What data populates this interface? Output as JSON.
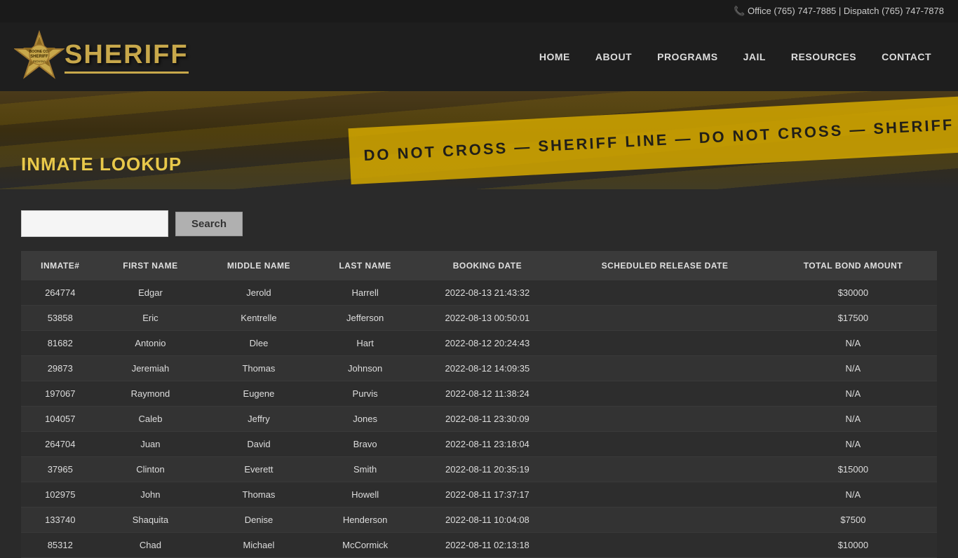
{
  "topbar": {
    "phone_icon": "📞",
    "office_label": "Office (765) 747-7885",
    "separator": "|",
    "dispatch_label": "Dispatch (765) 747-7878"
  },
  "nav": {
    "logo_text": "SHERIFF",
    "links": [
      {
        "label": "HOME",
        "id": "home"
      },
      {
        "label": "ABOUT",
        "id": "about"
      },
      {
        "label": "PROGRAMS",
        "id": "programs"
      },
      {
        "label": "JAIL",
        "id": "jail"
      },
      {
        "label": "RESOURCES",
        "id": "resources"
      },
      {
        "label": "CONTACT",
        "id": "contact"
      }
    ]
  },
  "hero": {
    "tape_text": "DO NOT CROSS — SHERIFF LINE — DO NOT CROSS — SHERIFF LINE — DO NOT CROSS",
    "page_title": "INMATE LOOKUP"
  },
  "search": {
    "input_value": "",
    "input_placeholder": "",
    "button_label": "Search"
  },
  "table": {
    "headers": [
      "INMATE#",
      "FIRST NAME",
      "MIDDLE NAME",
      "LAST NAME",
      "BOOKING DATE",
      "SCHEDULED RELEASE DATE",
      "TOTAL BOND AMOUNT"
    ],
    "rows": [
      {
        "id": "264774",
        "first": "Edgar",
        "middle": "Jerold",
        "last": "Harrell",
        "booking": "2022-08-13 21:43:32",
        "release": "",
        "bond": "$30000"
      },
      {
        "id": "53858",
        "first": "Eric",
        "middle": "Kentrelle",
        "last": "Jefferson",
        "booking": "2022-08-13 00:50:01",
        "release": "",
        "bond": "$17500"
      },
      {
        "id": "81682",
        "first": "Antonio",
        "middle": "Dlee",
        "last": "Hart",
        "booking": "2022-08-12 20:24:43",
        "release": "",
        "bond": "N/A"
      },
      {
        "id": "29873",
        "first": "Jeremiah",
        "middle": "Thomas",
        "last": "Johnson",
        "booking": "2022-08-12 14:09:35",
        "release": "",
        "bond": "N/A"
      },
      {
        "id": "197067",
        "first": "Raymond",
        "middle": "Eugene",
        "last": "Purvis",
        "booking": "2022-08-12 11:38:24",
        "release": "",
        "bond": "N/A"
      },
      {
        "id": "104057",
        "first": "Caleb",
        "middle": "Jeffry",
        "last": "Jones",
        "booking": "2022-08-11 23:30:09",
        "release": "",
        "bond": "N/A"
      },
      {
        "id": "264704",
        "first": "Juan",
        "middle": "David",
        "last": "Bravo",
        "booking": "2022-08-11 23:18:04",
        "release": "",
        "bond": "N/A"
      },
      {
        "id": "37965",
        "first": "Clinton",
        "middle": "Everett",
        "last": "Smith",
        "booking": "2022-08-11 20:35:19",
        "release": "",
        "bond": "$15000"
      },
      {
        "id": "102975",
        "first": "John",
        "middle": "Thomas",
        "last": "Howell",
        "booking": "2022-08-11 17:37:17",
        "release": "",
        "bond": "N/A"
      },
      {
        "id": "133740",
        "first": "Shaquita",
        "middle": "Denise",
        "last": "Henderson",
        "booking": "2022-08-11 10:04:08",
        "release": "",
        "bond": "$7500"
      },
      {
        "id": "85312",
        "first": "Chad",
        "middle": "Michael",
        "last": "McCormick",
        "booking": "2022-08-11 02:13:18",
        "release": "",
        "bond": "$10000"
      }
    ]
  }
}
